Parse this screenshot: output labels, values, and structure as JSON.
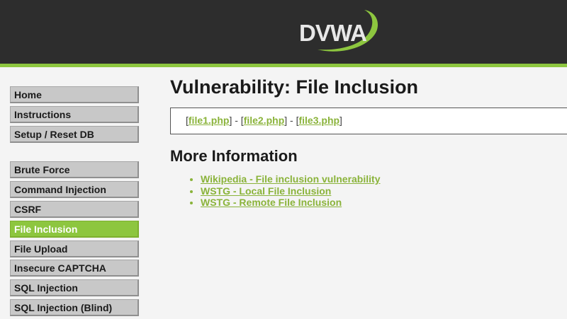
{
  "header": {
    "logo_text": "DVWA",
    "colors": {
      "background": "#2d2d2d",
      "accent": "#8dc63f"
    }
  },
  "menu": {
    "groups": [
      [
        {
          "label": "Home"
        },
        {
          "label": "Instructions"
        },
        {
          "label": "Setup / Reset DB"
        }
      ],
      [
        {
          "label": "Brute Force"
        },
        {
          "label": "Command Injection"
        },
        {
          "label": "CSRF"
        },
        {
          "label": "File Inclusion",
          "selected": true
        },
        {
          "label": "File Upload"
        },
        {
          "label": "Insecure CAPTCHA"
        },
        {
          "label": "SQL Injection"
        },
        {
          "label": "SQL Injection (Blind)"
        }
      ]
    ]
  },
  "main": {
    "title": "Vulnerability: File Inclusion",
    "files": [
      {
        "label": "file1.php"
      },
      {
        "label": "file2.php"
      },
      {
        "label": "file3.php"
      }
    ],
    "more_info": {
      "title": "More Information",
      "links": [
        {
          "label": "Wikipedia - File inclusion vulnerability"
        },
        {
          "label": "WSTG - Local File Inclusion"
        },
        {
          "label": "WSTG - Remote File Inclusion"
        }
      ]
    }
  }
}
